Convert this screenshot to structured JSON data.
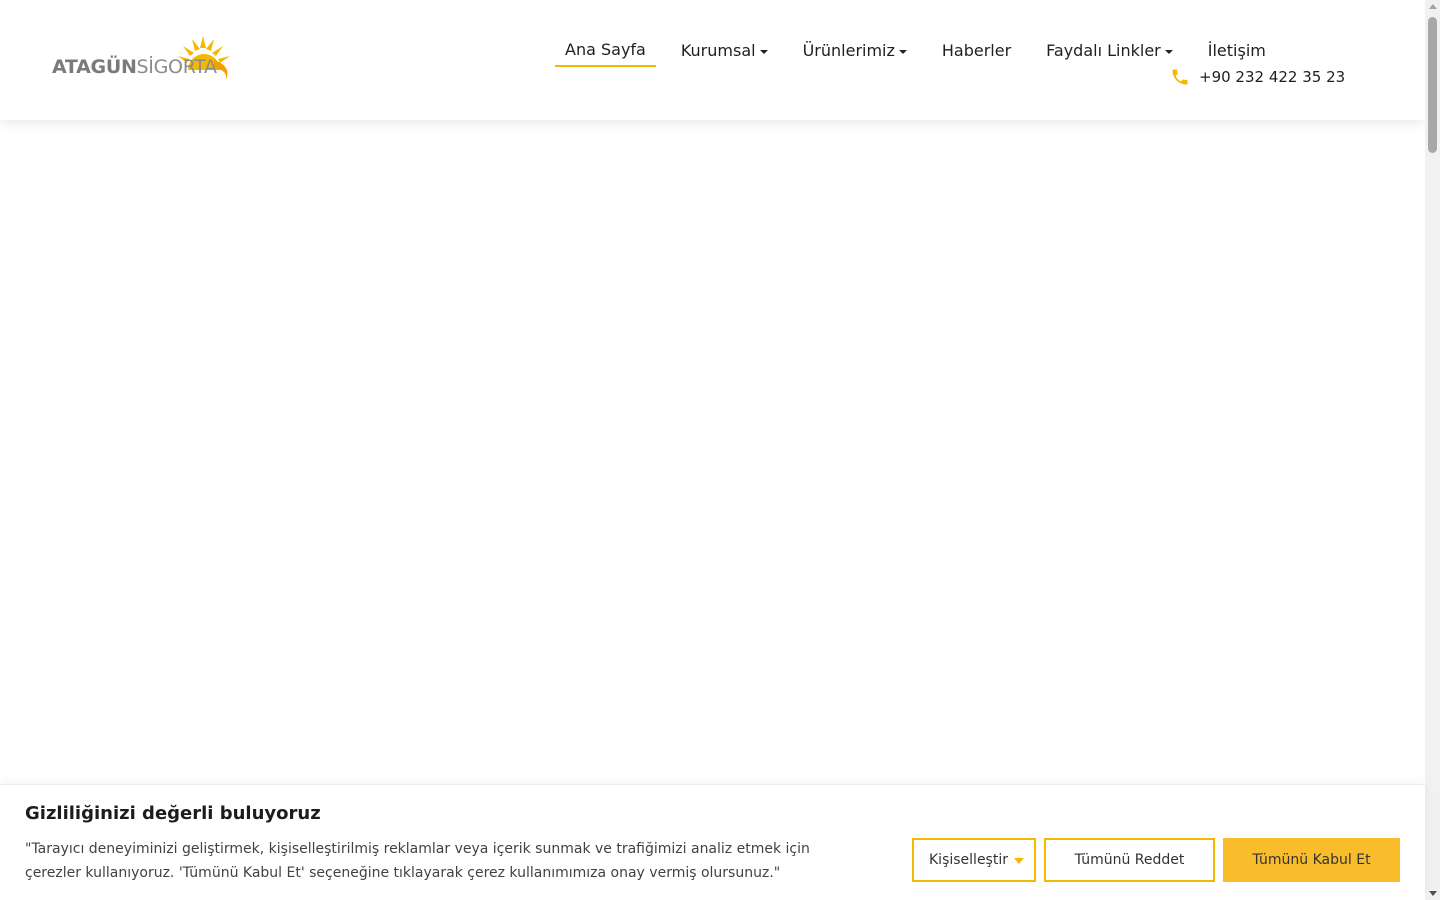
{
  "header": {
    "logo": {
      "bold": "ATAGÜN",
      "light": "SİGORTA"
    },
    "nav": [
      {
        "label": "Ana Sayfa",
        "active": true,
        "dropdown": false
      },
      {
        "label": "Kurumsal",
        "active": false,
        "dropdown": true
      },
      {
        "label": "Ürünlerimiz",
        "active": false,
        "dropdown": true
      },
      {
        "label": "Haberler",
        "active": false,
        "dropdown": false
      },
      {
        "label": "Faydalı Linkler",
        "active": false,
        "dropdown": true
      },
      {
        "label": "İletişim",
        "active": false,
        "dropdown": false
      }
    ],
    "phone": "+90 232 422 35 23"
  },
  "cookie_banner": {
    "title": "Gizliliğinizi değerli buluyoruz",
    "text": "\"Tarayıcı deneyiminizi geliştirmek, kişiselleştirilmiş reklamlar veya içerik sunmak ve trafiğimizi analiz etmek için çerezler kullanıyoruz. 'Tümünü Kabul Et' seçeneğine tıklayarak çerez kullanımımıza onay vermiş olursunuz.\"",
    "customize_label": "Kişiselleştir",
    "reject_label": "Tümünü Reddet",
    "accept_label": "Tümünü Kabul Et"
  },
  "colors": {
    "accent": "#f5b800",
    "accept_bg": "#f9bd2b",
    "logo_gray": "#7a7a7a"
  }
}
